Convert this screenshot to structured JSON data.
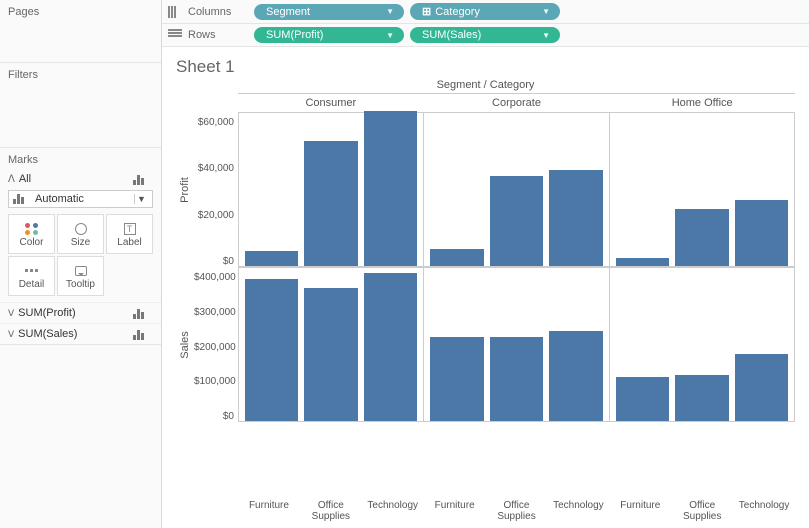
{
  "panels": {
    "pages": "Pages",
    "filters": "Filters",
    "marks": "Marks",
    "all": "All",
    "marks_type": "Automatic",
    "buttons": {
      "color": "Color",
      "size": "Size",
      "label": "Label",
      "detail": "Detail",
      "tooltip": "Tooltip"
    },
    "measures": [
      "SUM(Profit)",
      "SUM(Sales)"
    ]
  },
  "shelves": {
    "columns_label": "Columns",
    "rows_label": "Rows",
    "columns": [
      {
        "label": "Segment",
        "plus": false
      },
      {
        "label": "Category",
        "plus": true
      }
    ],
    "rows": [
      {
        "label": "SUM(Profit)"
      },
      {
        "label": "SUM(Sales)"
      }
    ]
  },
  "sheet": {
    "title": "Sheet 1",
    "header_title": "Segment / Category"
  },
  "chart_data": [
    {
      "type": "bar",
      "ylabel": "Profit",
      "ylim": [
        0,
        70000
      ],
      "yticks": [
        "$60,000",
        "$40,000",
        "$20,000",
        "$0"
      ],
      "segments": [
        "Consumer",
        "Corporate",
        "Home Office"
      ],
      "categories": [
        "Furniture",
        "Office Supplies",
        "Technology"
      ],
      "series": [
        {
          "segment": "Consumer",
          "values": [
            7000,
            57000,
            71000
          ]
        },
        {
          "segment": "Corporate",
          "values": [
            8000,
            41000,
            44000
          ]
        },
        {
          "segment": "Home Office",
          "values": [
            3500,
            26000,
            30000
          ]
        }
      ]
    },
    {
      "type": "bar",
      "ylabel": "Sales",
      "ylim": [
        0,
        420000
      ],
      "yticks": [
        "$400,000",
        "$300,000",
        "$200,000",
        "$100,000",
        "$0"
      ],
      "segments": [
        "Consumer",
        "Corporate",
        "Home Office"
      ],
      "categories": [
        "Furniture",
        "Office Supplies",
        "Technology"
      ],
      "series": [
        {
          "segment": "Consumer",
          "values": [
            390000,
            365000,
            405000
          ]
        },
        {
          "segment": "Corporate",
          "values": [
            230000,
            232000,
            248000
          ]
        },
        {
          "segment": "Home Office",
          "values": [
            122000,
            125000,
            185000
          ]
        }
      ]
    }
  ]
}
